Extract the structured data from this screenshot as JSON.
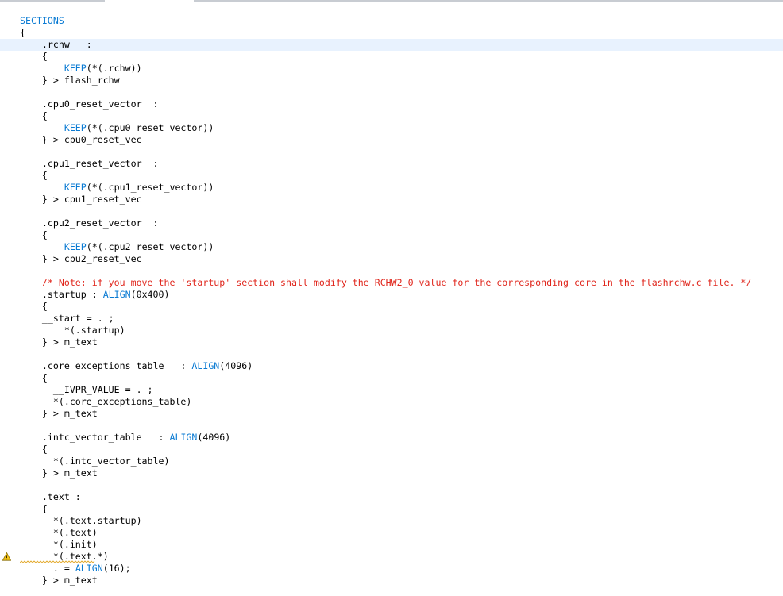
{
  "editor": {
    "highlighted_line": 2,
    "warning_line": 45,
    "warning_icon": "warning-icon",
    "colors": {
      "keyword": "#0b7bd3",
      "comment": "#e0261c",
      "current_line": "#e8f2fe"
    },
    "lines": [
      [
        {
          "t": "SECTIONS",
          "c": "kw"
        }
      ],
      [
        {
          "t": "{",
          "c": "pl"
        }
      ],
      [
        {
          "t": "    .rchw   :",
          "c": "pl"
        }
      ],
      [
        {
          "t": "    {",
          "c": "pl"
        }
      ],
      [
        {
          "t": "        ",
          "c": "pl"
        },
        {
          "t": "KEEP",
          "c": "kw"
        },
        {
          "t": "(*(.rchw))",
          "c": "pl"
        }
      ],
      [
        {
          "t": "    } > flash_rchw",
          "c": "pl"
        }
      ],
      [],
      [
        {
          "t": "    .cpu0_reset_vector  :",
          "c": "pl"
        }
      ],
      [
        {
          "t": "    {",
          "c": "pl"
        }
      ],
      [
        {
          "t": "        ",
          "c": "pl"
        },
        {
          "t": "KEEP",
          "c": "kw"
        },
        {
          "t": "(*(.cpu0_reset_vector))",
          "c": "pl"
        }
      ],
      [
        {
          "t": "    } > cpu0_reset_vec",
          "c": "pl"
        }
      ],
      [],
      [
        {
          "t": "    .cpu1_reset_vector  :",
          "c": "pl"
        }
      ],
      [
        {
          "t": "    {",
          "c": "pl"
        }
      ],
      [
        {
          "t": "        ",
          "c": "pl"
        },
        {
          "t": "KEEP",
          "c": "kw"
        },
        {
          "t": "(*(.cpu1_reset_vector))",
          "c": "pl"
        }
      ],
      [
        {
          "t": "    } > cpu1_reset_vec",
          "c": "pl"
        }
      ],
      [],
      [
        {
          "t": "    .cpu2_reset_vector  :",
          "c": "pl"
        }
      ],
      [
        {
          "t": "    {",
          "c": "pl"
        }
      ],
      [
        {
          "t": "        ",
          "c": "pl"
        },
        {
          "t": "KEEP",
          "c": "kw"
        },
        {
          "t": "(*(.cpu2_reset_vector))",
          "c": "pl"
        }
      ],
      [
        {
          "t": "    } > cpu2_reset_vec",
          "c": "pl"
        }
      ],
      [],
      [
        {
          "t": "    /* Note: if you move the 'startup' section shall modify the RCHW2_0 value for the corresponding core in the flashrchw.c file. */",
          "c": "cm"
        }
      ],
      [
        {
          "t": "    .startup : ",
          "c": "pl"
        },
        {
          "t": "ALIGN",
          "c": "kw"
        },
        {
          "t": "(0x400)",
          "c": "pl"
        }
      ],
      [
        {
          "t": "    {",
          "c": "pl"
        }
      ],
      [
        {
          "t": "    __start = . ;",
          "c": "pl"
        }
      ],
      [
        {
          "t": "        *(.startup)",
          "c": "pl"
        }
      ],
      [
        {
          "t": "    } > m_text",
          "c": "pl"
        }
      ],
      [],
      [
        {
          "t": "    .core_exceptions_table   : ",
          "c": "pl"
        },
        {
          "t": "ALIGN",
          "c": "kw"
        },
        {
          "t": "(4096)",
          "c": "pl"
        }
      ],
      [
        {
          "t": "    {",
          "c": "pl"
        }
      ],
      [
        {
          "t": "      __IVPR_VALUE = . ;",
          "c": "pl"
        }
      ],
      [
        {
          "t": "      *(.core_exceptions_table)",
          "c": "pl"
        }
      ],
      [
        {
          "t": "    } > m_text",
          "c": "pl"
        }
      ],
      [],
      [
        {
          "t": "    .intc_vector_table   : ",
          "c": "pl"
        },
        {
          "t": "ALIGN",
          "c": "kw"
        },
        {
          "t": "(4096)",
          "c": "pl"
        }
      ],
      [
        {
          "t": "    {",
          "c": "pl"
        }
      ],
      [
        {
          "t": "      *(.intc_vector_table)",
          "c": "pl"
        }
      ],
      [
        {
          "t": "    } > m_text",
          "c": "pl"
        }
      ],
      [],
      [
        {
          "t": "    .text :",
          "c": "pl"
        }
      ],
      [
        {
          "t": "    {",
          "c": "pl"
        }
      ],
      [
        {
          "t": "      *(.text.startup)",
          "c": "pl"
        }
      ],
      [
        {
          "t": "      *(.text)",
          "c": "pl"
        }
      ],
      [
        {
          "t": "      *(.init)",
          "c": "pl"
        }
      ],
      [
        {
          "t": "      *(.text.*)",
          "c": "pl"
        }
      ],
      [
        {
          "t": "      . = ",
          "c": "pl"
        },
        {
          "t": "ALIGN",
          "c": "kw"
        },
        {
          "t": "(16);",
          "c": "pl"
        }
      ],
      [
        {
          "t": "    } > m_text",
          "c": "pl"
        }
      ]
    ]
  }
}
